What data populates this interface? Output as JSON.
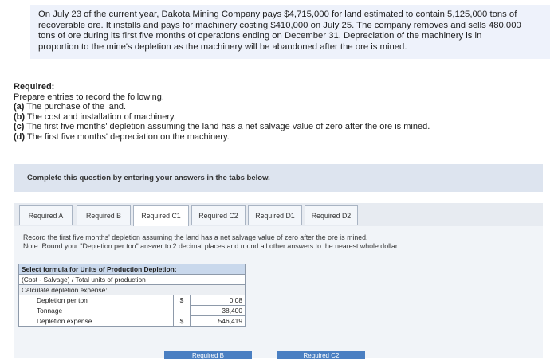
{
  "problem": {
    "lines": [
      "On July 23 of the current year, Dakota Mining Company pays $4,715,000 for land estimated to contain 5,125,000 tons of",
      "recoverable ore. It installs and pays for machinery costing $410,000 on July 25. The company removes and sells 480,000",
      "tons of ore during its first five months of operations ending on December 31. Depreciation of the machinery is in",
      "proportion to the mine's depletion as the machinery will be abandoned after the ore is mined."
    ]
  },
  "required": {
    "title": "Required:",
    "intro": "Prepare entries to record the following.",
    "items": [
      {
        "letter": "(a)",
        "text": " The purchase of the land."
      },
      {
        "letter": "(b)",
        "text": " The cost and installation of machinery."
      },
      {
        "letter": "(c)",
        "text": " The first five months' depletion assuming the land has a net salvage value of zero after the ore is mined."
      },
      {
        "letter": "(d)",
        "text": " The first five months' depreciation on the machinery."
      }
    ]
  },
  "banner": "Complete this question by entering your answers in the tabs below.",
  "tabs": [
    "Required A",
    "Required B",
    "Required C1",
    "Required C2",
    "Required D1",
    "Required D2"
  ],
  "instruction": {
    "line1": "Record the first five months' depletion assuming the land has a net salvage value of zero after the ore is mined.",
    "line2": "Note: Round your \"Depletion per ton\" answer to 2 decimal places and round all other answers to the nearest whole dollar."
  },
  "grid": {
    "header": "Select formula for Units of Production Depletion:",
    "formula": "(Cost - Salvage) / Total units of production",
    "calc_label": "Calculate depletion expense:",
    "rows": [
      {
        "label": "Depletion per ton",
        "dollar": "$",
        "value": "0.08"
      },
      {
        "label": "Tonnage",
        "dollar": "",
        "value": "38,400"
      },
      {
        "label": "Depletion expense",
        "dollar": "$",
        "value": "546,419"
      }
    ]
  },
  "nav": {
    "prev": "Required B",
    "next": "Required C2"
  }
}
